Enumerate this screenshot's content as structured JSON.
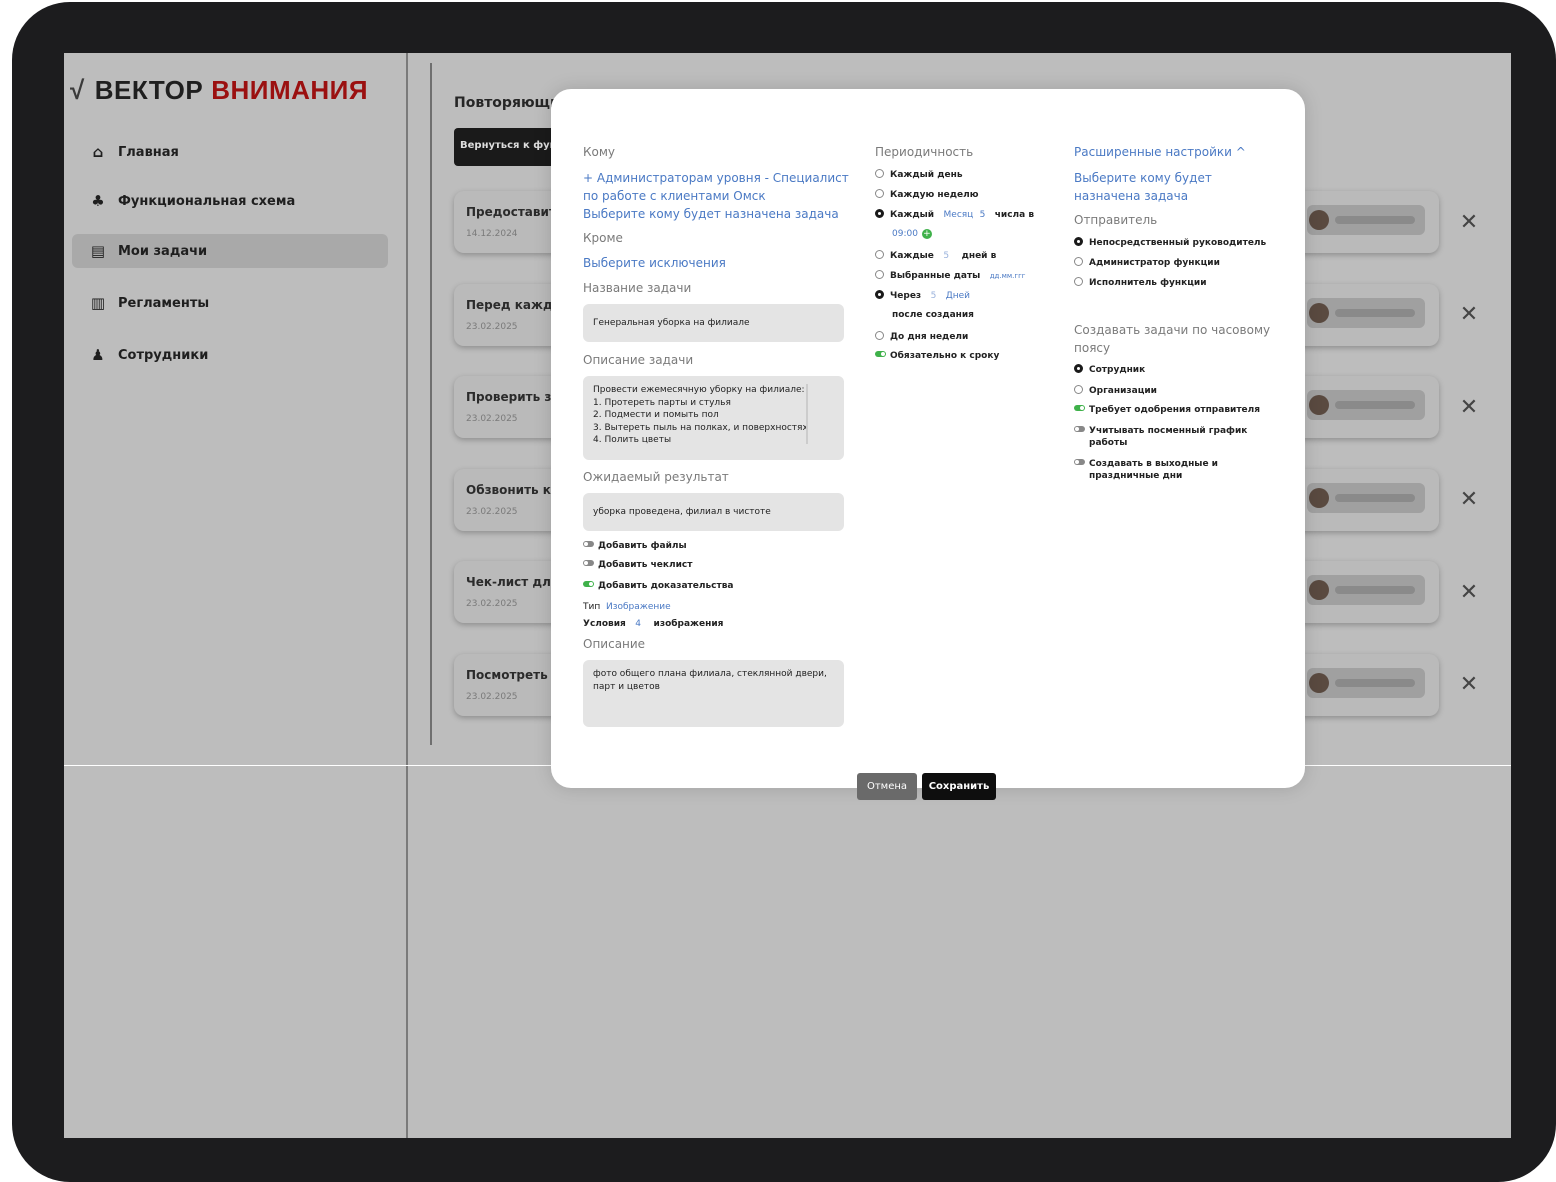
{
  "logo": {
    "mark": "√",
    "word1": "ВЕКТОР",
    "word2": "ВНИМАНИЯ"
  },
  "sidebar": {
    "items": [
      {
        "label": "Главная",
        "icon": "home-icon",
        "glyph": "⌂",
        "active": false
      },
      {
        "label": "Функциональная схема",
        "icon": "hierarchy-icon",
        "glyph": "♣",
        "active": false
      },
      {
        "label": "Мои задачи",
        "icon": "tasks-icon",
        "glyph": "▤",
        "active": true
      },
      {
        "label": "Регламенты",
        "icon": "book-icon",
        "glyph": "▥",
        "active": false
      },
      {
        "label": "Сотрудники",
        "icon": "people-icon",
        "glyph": "♟",
        "active": false
      }
    ]
  },
  "main": {
    "title": "Повторяющие",
    "back_label": "Вернуться к функ",
    "tasks": [
      {
        "title": "Предоставить",
        "date": "14.12.2024"
      },
      {
        "title": "Перед кажды",
        "date": "23.02.2025"
      },
      {
        "title": "Проверить за",
        "date": "23.02.2025"
      },
      {
        "title": "Обзвонить кур",
        "date": "23.02.2025"
      },
      {
        "title": "Чек-лист для с",
        "date": "23.02.2025"
      },
      {
        "title": "Посмотреть на",
        "date": "23.02.2025"
      }
    ],
    "close_glyph": "✕"
  },
  "modal": {
    "col1": {
      "to_label": "Кому",
      "recipient": "+ Администраторам уровня - Специалист",
      "recipient_line2": "по работе с клиентами Омск",
      "choose_assignee": "Выберите кому будет назначена задача",
      "except_label": "Кроме",
      "choose_exceptions": "Выберите исключения",
      "name_label": "Название задачи",
      "name_value": "Генеральная уборка на филиале",
      "desc_label": "Описание задачи",
      "desc_lines": [
        "Провести ежемесячную уборку на филиале:",
        "1. Протереть парты и стулья",
        "2. Подмести и помыть пол",
        "3. Вытереть пыль на полках, и поверхностях",
        "4. Полить цветы"
      ],
      "result_label": "Ожидаемый результат",
      "result_value": "уборка проведена, филиал в чистоте",
      "toggles": [
        {
          "label": "Добавить файлы",
          "on": false
        },
        {
          "label": "Добавить чеклист",
          "on": false
        },
        {
          "label": "Добавить доказательства",
          "on": true
        }
      ],
      "type_label": "Тип",
      "type_value": "Изображение",
      "cond_label": "Условия",
      "cond_value": "4",
      "cond_suffix": "изображения",
      "desc2_label": "Описание",
      "desc2_value_line1": "фото общего плана филиала, стеклянной двери,",
      "desc2_value_line2": "парт и цветов"
    },
    "col2": {
      "period_label": "Периодичность",
      "opt_daily": "Каждый день",
      "opt_weekly": "Каждую неделю",
      "opt_each": "Каждый",
      "opt_each_unit": "Месяц",
      "opt_each_num": "5",
      "opt_each_suffix": "числа в",
      "opt_each_time": "09:00",
      "opt_every": "Каждые",
      "opt_every_num": "5",
      "opt_every_suffix": "дней в",
      "opt_dates": "Выбранные даты",
      "opt_dates_ph": "дд.мм.ггг",
      "opt_after": "Через",
      "opt_after_num": "5",
      "opt_after_unit": "Дней",
      "opt_after_suffix": "после создания",
      "opt_weekday": "До дня недели",
      "opt_deadline": "Обязательно к сроку"
    },
    "col3": {
      "advanced": "Расширенные настройки ^",
      "choose_line1": "Выберите кому будет",
      "choose_line2": "назначена задача",
      "sender_label": "Отправитель",
      "sender_opts": [
        "Непосредственный руководитель",
        "Администратор функции",
        "Исполнитель функции"
      ],
      "tz_label_line1": "Создавать задачи по часовому",
      "tz_label_line2": "поясу",
      "tz_opts": [
        "Сотрудник",
        "Организации"
      ],
      "toggle_approval": "Требует одобрения отправителя",
      "toggle_shift_line1": "Учитывать посменный график",
      "toggle_shift_line2": "работы",
      "toggle_weekend_line1": "Создавать в выходные и",
      "toggle_weekend_line2": "праздничные дни"
    },
    "cancel": "Отмена",
    "save": "Сохранить"
  },
  "colors": {
    "accent_link": "#4a79c4",
    "brand_red": "#9b1010",
    "toggle_on": "#3fb14a"
  }
}
